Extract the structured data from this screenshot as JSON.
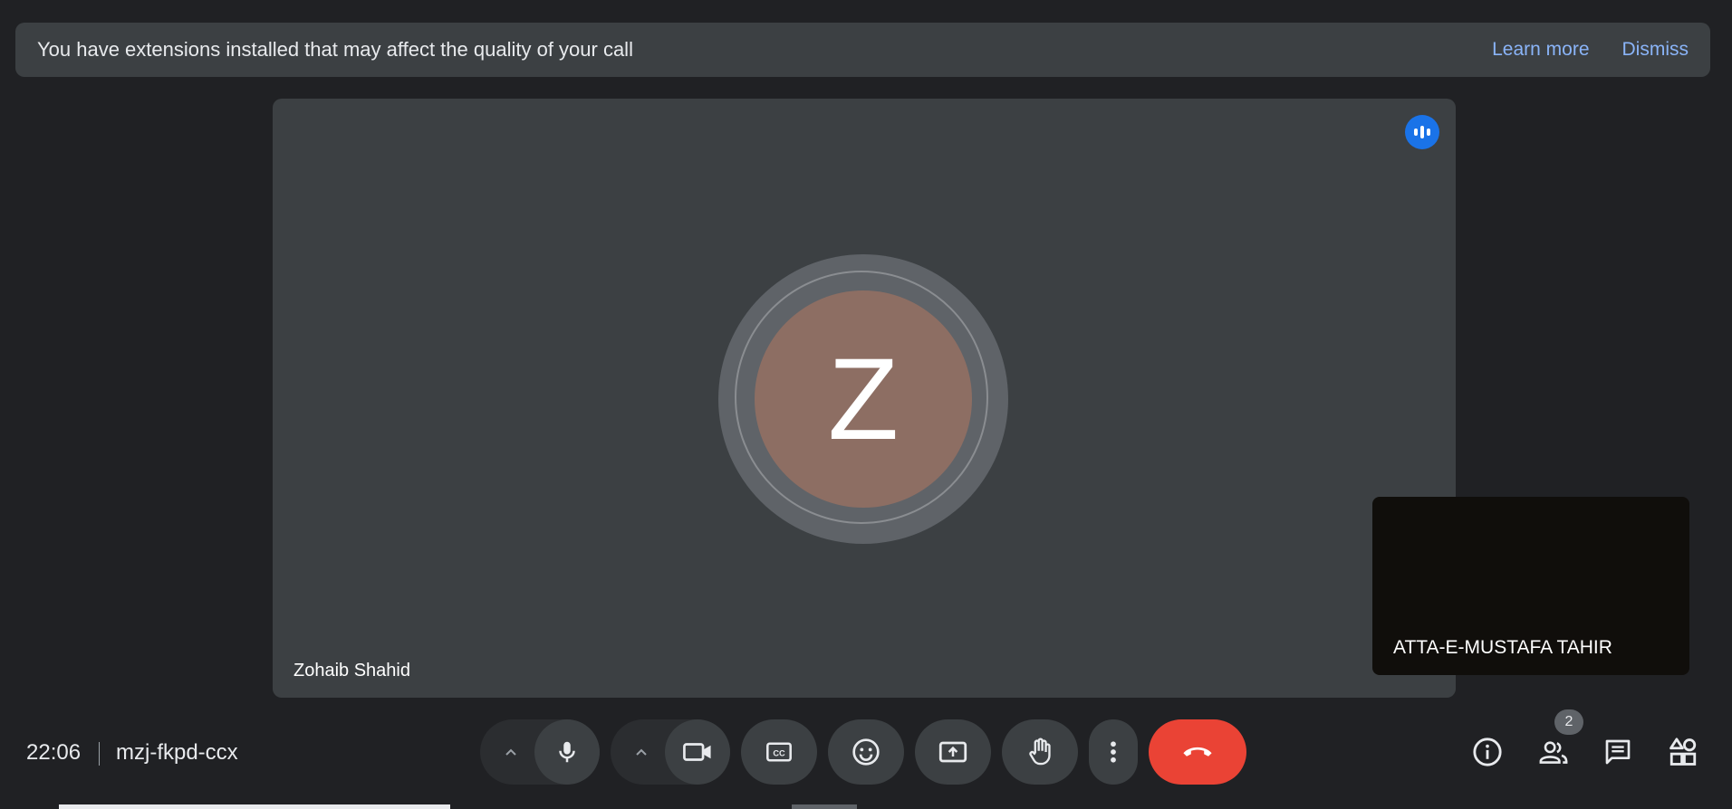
{
  "banner": {
    "message": "You have extensions installed that may affect the quality of your call",
    "learn_more": "Learn more",
    "dismiss": "Dismiss"
  },
  "main_participant": {
    "initial": "Z",
    "name": "Zohaib Shahid",
    "avatar_color": "#8d6e63",
    "speaking_indicator_color": "#1a73e8"
  },
  "self_view": {
    "name": "ATTA-E-MUSTAFA TAHIR"
  },
  "meeting": {
    "time": "22:06",
    "code": "mzj-fkpd-ccx"
  },
  "controls": {
    "end_call_color": "#ea4335",
    "icons": [
      "chevron-up-icon",
      "microphone-icon",
      "chevron-up-icon",
      "camera-icon",
      "captions-icon",
      "emoji-icon",
      "present-screen-icon",
      "raise-hand-icon",
      "more-options-icon",
      "end-call-icon"
    ]
  },
  "right_controls": {
    "people_count": "2",
    "icons": [
      "info-icon",
      "people-icon",
      "chat-icon",
      "activities-icon"
    ]
  }
}
